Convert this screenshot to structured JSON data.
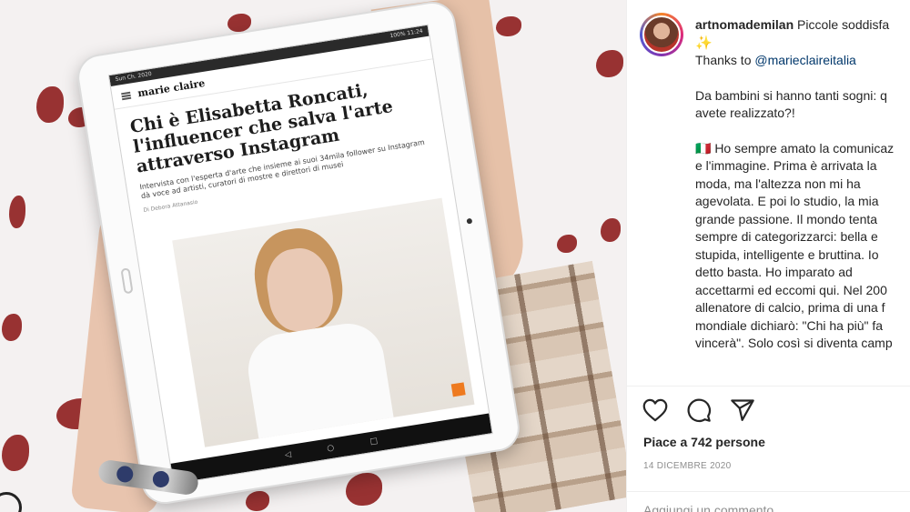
{
  "post": {
    "username": "artnomademilan",
    "caption_first_line": "Piccole soddisfa",
    "sparkle": "✨",
    "thanks_prefix": "Thanks to",
    "mention": "@marieclaireitalia",
    "paragraph_2": [
      "Da bambini si hanno tanti sogni: q",
      "avete realizzato?!"
    ],
    "paragraph_3": [
      "🇮🇹 Ho sempre amato la comunicaz",
      "e l'immagine. Prima è arrivata la",
      "moda, ma l'altezza non mi ha",
      "agevolata. E poi lo studio, la mia",
      "grande passione. Il mondo tenta",
      "sempre di categorizzarci: bella e",
      "stupida, intelligente e bruttina. Io",
      "detto basta. Ho imparato ad",
      "accettarmi ed eccomi qui. Nel 200",
      "allenatore di calcio, prima di una f",
      "mondiale dichiarò: \"Chi ha più\" fa",
      "vincerà\". Solo così si diventa camp"
    ],
    "likes_text": "Piace a 742 persone",
    "date_text": "14 DICEMBRE 2020",
    "comment_placeholder": "Aggiungi un commento..."
  },
  "icons": {
    "like": "heart-icon",
    "comment": "comment-icon",
    "share": "send-icon"
  },
  "tablet_article": {
    "status_left": "Sun Ch. 2020",
    "status_right": "100% 11:24",
    "logo": "marie claire",
    "title": "Chi è Elisabetta Roncati, l'influencer che salva l'arte attraverso Instagram",
    "subtitle": "Intervista con l'esperta d'arte che insieme ai suoi 34mila follower su Instagram dà voce ad artisti, curatori di mostre e direttori di musei",
    "author": "Di Debora Attanasio"
  },
  "colors": {
    "text": "#262626",
    "muted": "#8e8e8e",
    "mention": "#00376b",
    "petal": "#8e1d1d"
  }
}
